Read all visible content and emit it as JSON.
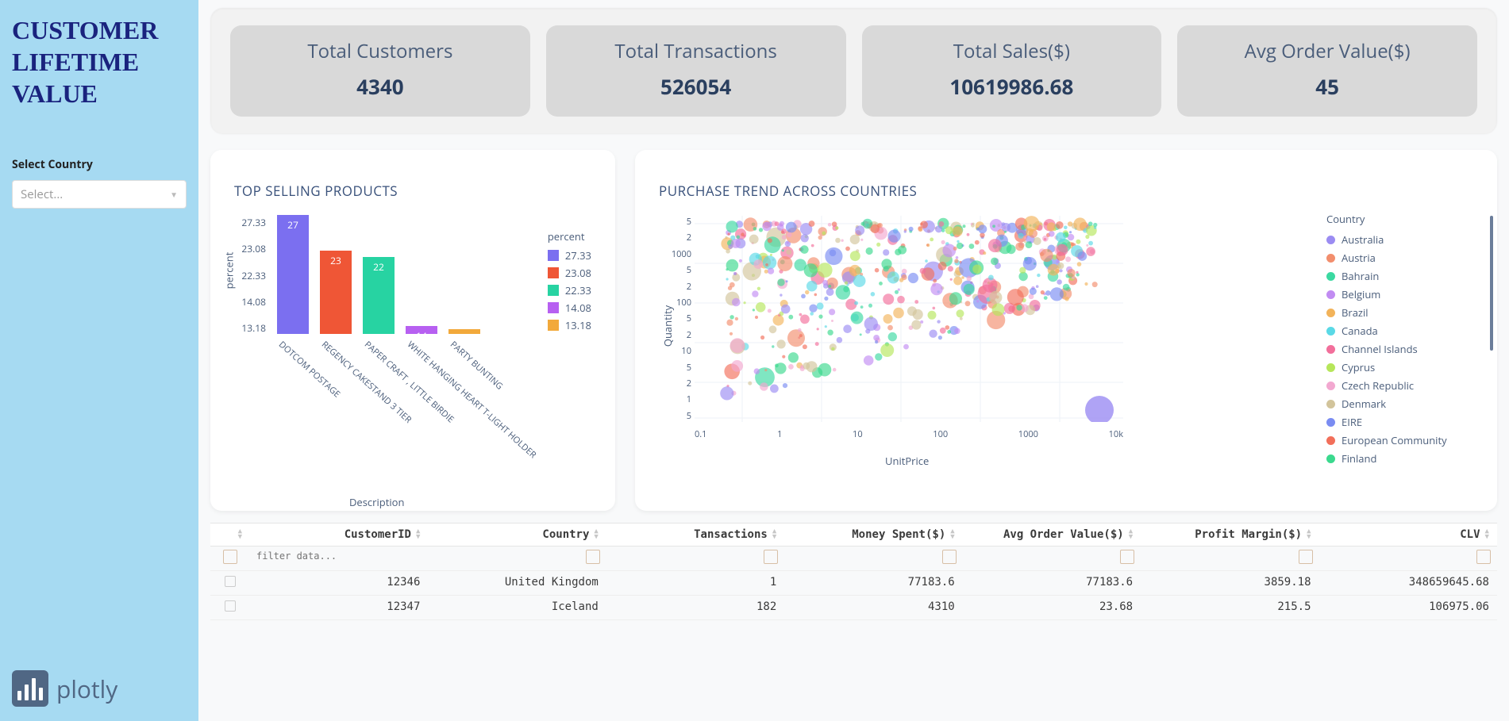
{
  "sidebar": {
    "title": "CUSTOMER LIFETIME VALUE",
    "country_label": "Select Country",
    "country_placeholder": "Select...",
    "logo_text": "plotly"
  },
  "kpis": [
    {
      "label": "Total Customers",
      "value": "4340"
    },
    {
      "label": "Total Transactions",
      "value": "526054"
    },
    {
      "label": "Total Sales($)",
      "value": "10619986.68"
    },
    {
      "label": "Avg Order Value($)",
      "value": "45"
    }
  ],
  "top_chart": {
    "title": "TOP SELLING PRODUCTS",
    "ylabel": "percent",
    "xlabel": "Description",
    "legend_title": "percent"
  },
  "trend_chart": {
    "title": "PURCHASE TREND ACROSS COUNTRIES",
    "xlabel": "UnitPrice",
    "ylabel": "Quantity",
    "legend_title": "Country",
    "legend_items": [
      {
        "name": "Australia",
        "color": "#9b8cf2"
      },
      {
        "name": "Austria",
        "color": "#f28e6d"
      },
      {
        "name": "Bahrain",
        "color": "#3bd9a1"
      },
      {
        "name": "Belgium",
        "color": "#c18cf2"
      },
      {
        "name": "Brazil",
        "color": "#f2b35a"
      },
      {
        "name": "Canada",
        "color": "#5ad9e6"
      },
      {
        "name": "Channel Islands",
        "color": "#f26f9b"
      },
      {
        "name": "Cyprus",
        "color": "#b6e65a"
      },
      {
        "name": "Czech Republic",
        "color": "#f2a8d0"
      },
      {
        "name": "Denmark",
        "color": "#d2c49b"
      },
      {
        "name": "EIRE",
        "color": "#7a8cf2"
      },
      {
        "name": "European Community",
        "color": "#f26f5a"
      },
      {
        "name": "Finland",
        "color": "#3bd98e"
      }
    ],
    "yticks": [
      "5",
      "2",
      "1000",
      "5",
      "2",
      "100",
      "5",
      "2",
      "10",
      "5",
      "2",
      "1",
      "5"
    ],
    "xticks": [
      "0.1",
      "1",
      "10",
      "100",
      "1000",
      "10k"
    ]
  },
  "table": {
    "columns": [
      "",
      "CustomerID",
      "Country",
      "Tansactions",
      "Money Spent($)",
      "Avg Order Value($)",
      "Profit Margin($)",
      "CLV"
    ],
    "filter_placeholder": "filter data...",
    "rows": [
      {
        "customer_id": "12346",
        "country": "United Kingdom",
        "transactions": "1",
        "money_spent": "77183.6",
        "avg_order": "77183.6",
        "profit_margin": "3859.18",
        "clv": "348659645.68"
      },
      {
        "customer_id": "12347",
        "country": "Iceland",
        "transactions": "182",
        "money_spent": "4310",
        "avg_order": "23.68",
        "profit_margin": "215.5",
        "clv": "106975.06"
      }
    ]
  },
  "chart_data": [
    {
      "type": "bar",
      "title": "TOP SELLING PRODUCTS",
      "xlabel": "Description",
      "ylabel": "percent",
      "categories": [
        "DOTCOM POSTAGE",
        "REGENCY CAKESTAND 3 TIER",
        "PAPER CRAFT , LITTLE BIRDIE",
        "WHITE HANGING HEART T-LIGHT HOLDER",
        "PARTY BUNTING"
      ],
      "values": [
        27.33,
        23.08,
        22.33,
        14.08,
        13.18
      ],
      "value_labels": [
        27,
        23,
        22,
        14,
        null
      ],
      "colors": [
        "#7b6ff0",
        "#ef5636",
        "#27d3a2",
        "#b760f1",
        "#f2a93b"
      ],
      "ylim": [
        13.18,
        27.33
      ],
      "yticks": [
        27.33,
        23.08,
        22.33,
        14.08,
        13.18
      ],
      "legend_title": "percent",
      "legend_entries": [
        "27.33",
        "23.08",
        "22.33",
        "14.08",
        "13.18"
      ]
    },
    {
      "type": "scatter",
      "title": "PURCHASE TREND ACROSS COUNTRIES",
      "xlabel": "UnitPrice",
      "ylabel": "Quantity",
      "x_scale": "log",
      "y_scale": "log",
      "xlim": [
        0.05,
        15000
      ],
      "ylim": [
        0.4,
        6000
      ],
      "legend_title": "Country",
      "series_names": [
        "Australia",
        "Austria",
        "Bahrain",
        "Belgium",
        "Brazil",
        "Canada",
        "Channel Islands",
        "Cyprus",
        "Czech Republic",
        "Denmark",
        "EIRE",
        "European Community",
        "Finland"
      ],
      "note": "Dense multi-country log-log bubble scatter; individual point values not labeled in source image."
    }
  ]
}
